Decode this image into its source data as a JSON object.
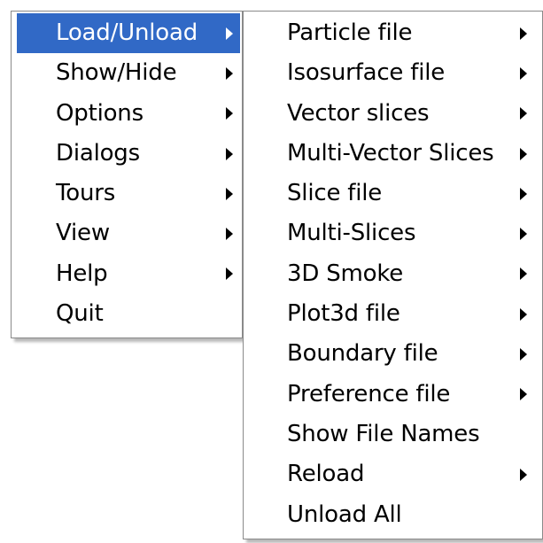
{
  "main_menu": {
    "items": [
      {
        "label": "Load/Unload",
        "has_submenu": true,
        "highlighted": true
      },
      {
        "label": "Show/Hide",
        "has_submenu": true
      },
      {
        "label": "Options",
        "has_submenu": true
      },
      {
        "label": "Dialogs",
        "has_submenu": true
      },
      {
        "label": "Tours",
        "has_submenu": true
      },
      {
        "label": "View",
        "has_submenu": true
      },
      {
        "label": "Help",
        "has_submenu": true
      },
      {
        "label": "Quit",
        "has_submenu": false
      }
    ]
  },
  "submenu": {
    "items": [
      {
        "label": "Particle file",
        "has_submenu": true
      },
      {
        "label": "Isosurface file",
        "has_submenu": true
      },
      {
        "label": "Vector slices",
        "has_submenu": true
      },
      {
        "label": "Multi-Vector Slices",
        "has_submenu": true
      },
      {
        "label": "Slice file",
        "has_submenu": true
      },
      {
        "label": "Multi-Slices",
        "has_submenu": true
      },
      {
        "label": "3D Smoke",
        "has_submenu": true
      },
      {
        "label": "Plot3d file",
        "has_submenu": true
      },
      {
        "label": "Boundary file",
        "has_submenu": true
      },
      {
        "label": "Preference file",
        "has_submenu": true
      },
      {
        "label": "Show File Names",
        "has_submenu": false
      },
      {
        "label": "Reload",
        "has_submenu": true
      },
      {
        "label": "Unload All",
        "has_submenu": false
      }
    ]
  },
  "colors": {
    "highlight": "#3169c6",
    "highlight_text": "#ffffff",
    "menu_bg": "#ffffff",
    "menu_border": "#8a8a8a"
  }
}
